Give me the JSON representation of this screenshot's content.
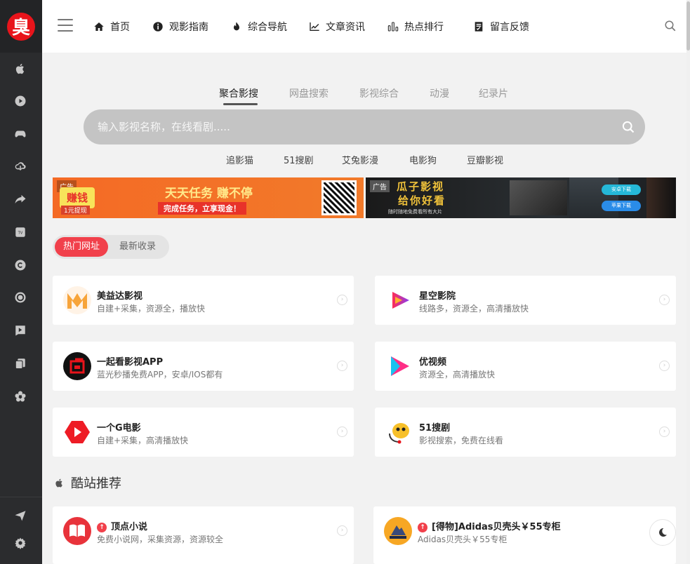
{
  "logo": {
    "text": "臭"
  },
  "nav": {
    "items": [
      {
        "label": "首页",
        "icon": "home-icon"
      },
      {
        "label": "观影指南",
        "icon": "info-icon"
      },
      {
        "label": "综合导航",
        "icon": "fire-icon"
      },
      {
        "label": "文章资讯",
        "icon": "chart-icon"
      },
      {
        "label": "热点排行",
        "icon": "bars-icon"
      },
      {
        "label": "留言反馈",
        "icon": "note-icon"
      }
    ]
  },
  "search": {
    "tabs": [
      "聚合影搜",
      "网盘搜索",
      "影视综合",
      "动漫",
      "纪录片"
    ],
    "active_tab": "聚合影搜",
    "placeholder": "输入影视名称，在线看剧.....",
    "sub_links": [
      "追影猫",
      "51搜剧",
      "艾兔影漫",
      "电影狗",
      "豆瓣影视"
    ]
  },
  "banners": {
    "left": {
      "tag": "广告",
      "badge": "赚钱",
      "badge_sub": "1元提现",
      "headline": "天天任务 赚不停",
      "subline": "完成任务，立享现金！"
    },
    "right": {
      "tag": "广告",
      "title": "瓜子影视",
      "slogan": "给你好看",
      "tagline": "随时随地免费看所有大片",
      "android_btn": "安卓下载",
      "ios_btn": "苹果下载"
    }
  },
  "pills": {
    "active": "热门网址",
    "inactive": "最新收录"
  },
  "cards": [
    {
      "title": "美益达影视",
      "desc": "自建+采集，资源全，播放快"
    },
    {
      "title": "星空影院",
      "desc": "线路多，资源全，高清播放快"
    },
    {
      "title": "一起看影视APP",
      "desc": "蓝光秒播免费APP，安卓/IOS都有"
    },
    {
      "title": "优视频",
      "desc": "资源全，高清播放快"
    },
    {
      "title": "一个G电影",
      "desc": "自建+采集，高清播放快"
    },
    {
      "title": "51搜剧",
      "desc": "影视搜索，免费在线看"
    }
  ],
  "section": {
    "title": "酷站推荐"
  },
  "cool_cards": [
    {
      "title": "顶点小说",
      "desc": "免费小说网，采集资源，资源较全"
    },
    {
      "title": "[得物]Adidas贝壳头￥55专柜",
      "desc": "Adidas贝壳头￥55专柜"
    }
  ],
  "colors": {
    "accent": "#f1404b",
    "sidebar": "#2b2c2e",
    "search_bg": "#c4c4c4"
  }
}
